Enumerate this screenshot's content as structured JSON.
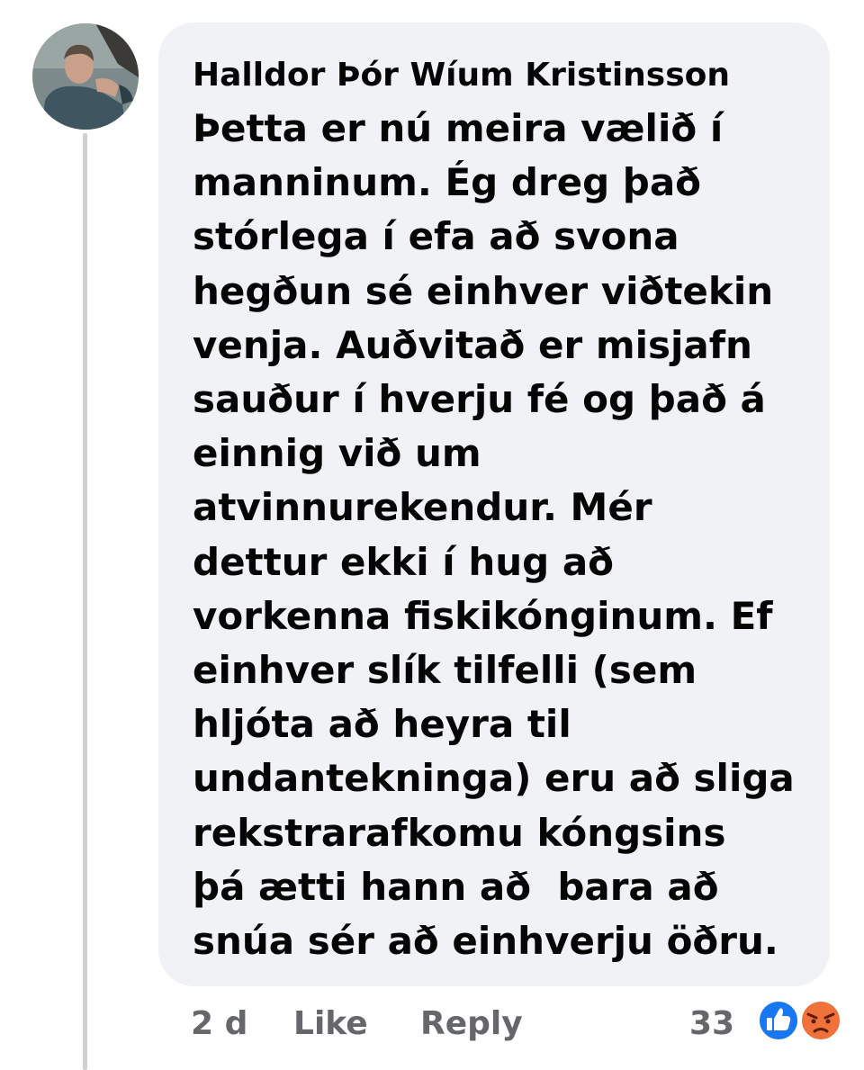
{
  "comment": {
    "author": "Halldor Þór Wíum Kristinsson",
    "text_lines": [
      "Þetta er nú meira vælið í",
      "manninum. Ég dreg það",
      "stórlega í efa að svona",
      "hegðun sé einhver viðtekin",
      "venja. Auðvitað er misjafn",
      "sauður í hverju fé og það á",
      "einnig við um",
      "atvinnurekendur. Mér",
      "dettur ekki í hug að",
      "vorkenna fiskikónginum. Ef",
      "einhver slík tilfelli (sem",
      "hljóta að heyra til",
      "undantekninga) eru að sliga",
      "rekstrarafkomu kóngsins",
      "þá ætti hann að  bara að",
      "snúa sér að einhverju öðru."
    ],
    "avatar_icon": "profile-photo"
  },
  "footer": {
    "time": "2 d",
    "like_label": "Like",
    "reply_label": "Reply",
    "reaction_count": "33",
    "reaction_icons": [
      "like-reaction-icon",
      "angry-reaction-icon"
    ]
  },
  "colors": {
    "bubble": "#f0f2f5",
    "text": "#050505",
    "secondary_text": "#65676b",
    "like_blue": "#1877f2",
    "angry_orange": "#f0713a",
    "thread_line": "#ced0d4"
  }
}
